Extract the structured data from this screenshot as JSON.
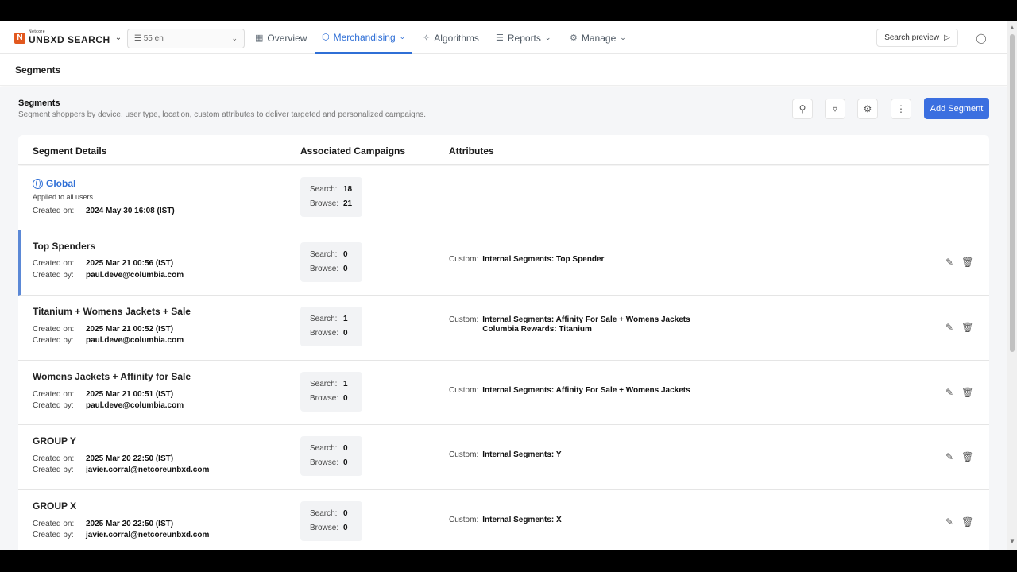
{
  "nav": {
    "logo_small": "Netcore",
    "logo_text": "UNBXD SEARCH",
    "site_value": "☰ 55 en",
    "items": [
      {
        "label": "Overview",
        "icon": "grid-icon"
      },
      {
        "label": "Merchandising",
        "icon": "cube-icon"
      },
      {
        "label": "Algorithms",
        "icon": "nodes-icon"
      },
      {
        "label": "Reports",
        "icon": "report-icon"
      },
      {
        "label": "Manage",
        "icon": "gear-icon"
      }
    ],
    "search_preview": "Search preview"
  },
  "breadcrumb": "Segments",
  "page": {
    "title": "Segments",
    "subtitle": "Segment shoppers by device, user type, location, custom attributes to deliver targeted and personalized campaigns.",
    "add_button": "Add Segment"
  },
  "table": {
    "headers": [
      "Segment Details",
      "Associated Campaigns",
      "Attributes"
    ],
    "labels": {
      "created_on": "Created on:",
      "created_by": "Created by:",
      "search": "Search:",
      "browse": "Browse:",
      "custom": "Custom:"
    },
    "rows": [
      {
        "name": "Global",
        "note": "Applied to all users",
        "created_on": "2024 May 30 16:08 (IST)",
        "search": "18",
        "browse": "21"
      },
      {
        "name": "Top Spenders",
        "created_on": "2025 Mar 21 00:56 (IST)",
        "created_by": "paul.deve@columbia.com",
        "search": "0",
        "browse": "0",
        "attr1": "Internal Segments: Top Spender"
      },
      {
        "name": "Titanium + Womens Jackets + Sale",
        "created_on": "2025 Mar 21 00:52 (IST)",
        "created_by": "paul.deve@columbia.com",
        "search": "1",
        "browse": "0",
        "attr1": "Internal Segments: Affinity For Sale + Womens Jackets",
        "attr2": "Columbia Rewards: Titanium"
      },
      {
        "name": "Womens Jackets + Affinity for Sale",
        "created_on": "2025 Mar 21 00:51 (IST)",
        "created_by": "paul.deve@columbia.com",
        "search": "1",
        "browse": "0",
        "attr1": "Internal Segments: Affinity For Sale + Womens Jackets"
      },
      {
        "name": "GROUP Y",
        "created_on": "2025 Mar 20 22:50 (IST)",
        "created_by": "javier.corral@netcoreunbxd.com",
        "search": "0",
        "browse": "0",
        "attr1": "Internal Segments: Y"
      },
      {
        "name": "GROUP X",
        "created_on": "2025 Mar 20 22:50 (IST)",
        "created_by": "javier.corral@netcoreunbxd.com",
        "search": "0",
        "browse": "0",
        "attr1": "Internal Segments: X"
      }
    ]
  },
  "colors": {
    "accent": "#2f6fd6",
    "button": "#3b6fe0",
    "logo": "#e2581e"
  }
}
